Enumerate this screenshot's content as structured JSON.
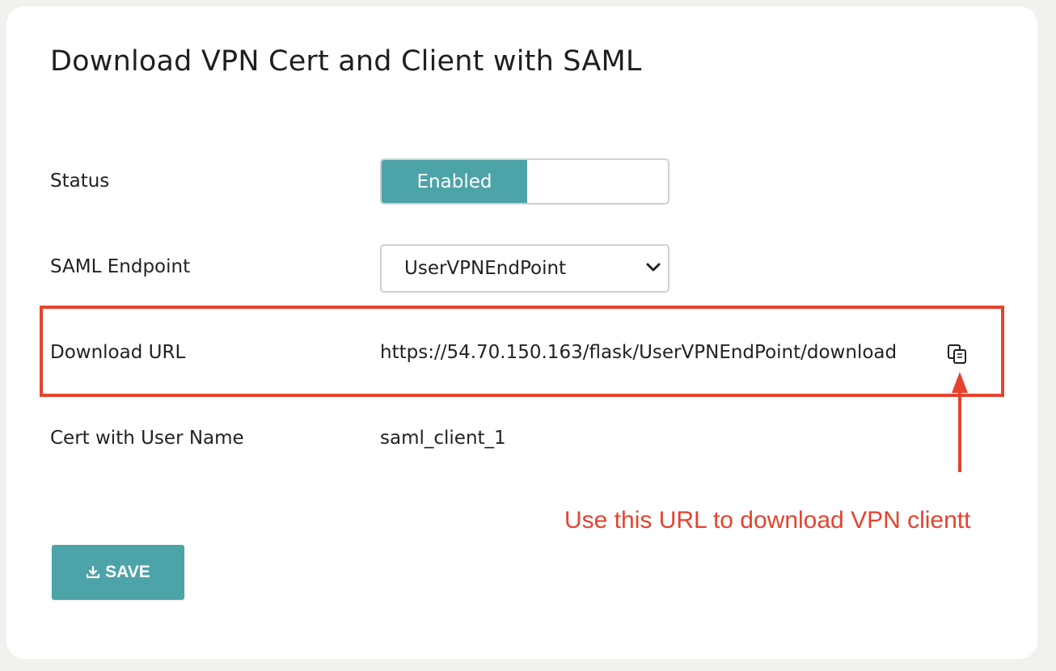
{
  "panel": {
    "title": "Download VPN Cert and Client with SAML"
  },
  "fields": {
    "status": {
      "label": "Status",
      "toggle_value": "Enabled",
      "enabled": true
    },
    "saml_endpoint": {
      "label": "SAML Endpoint",
      "selected": "UserVPNEndPoint"
    },
    "download_url": {
      "label": "Download URL",
      "value": "https://54.70.150.163/flask/UserVPNEndPoint/download",
      "copy_icon": "copy-icon"
    },
    "cert_user": {
      "label": "Cert with User Name",
      "value": "saml_client_1"
    }
  },
  "annotation": {
    "text": "Use this URL to download VPN clientt",
    "color": "#e5432e"
  },
  "actions": {
    "save_label": "SAVE",
    "save_icon": "download-tray-icon"
  },
  "colors": {
    "accent": "#4ca3a8",
    "background": "#f2f1ed",
    "card": "#ffffff"
  }
}
